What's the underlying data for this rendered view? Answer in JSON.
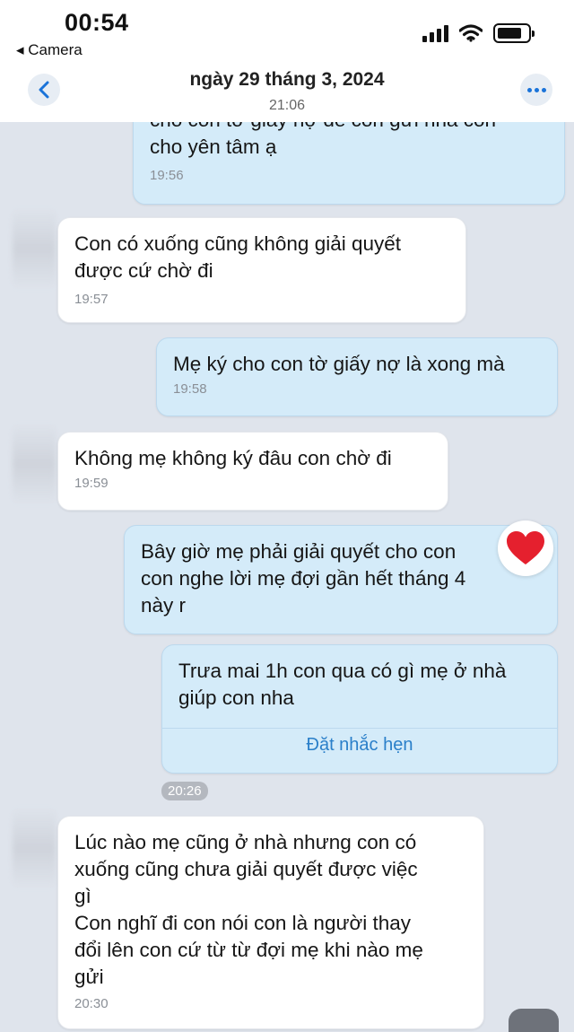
{
  "status_bar": {
    "time": "00:54",
    "back_label": "◂ Camera"
  },
  "header": {
    "title": "ngày 29 tháng 3, 2024",
    "subtitle": "21:06"
  },
  "messages": [
    {
      "direction": "out",
      "text": "cho con tờ giấy nợ để con gửi nha con\ncho yên tâm ạ",
      "time": "19:56"
    },
    {
      "direction": "in",
      "text": "Con có xuống cũng không giải quyết\nđược cứ chờ đi",
      "time": "19:57"
    },
    {
      "direction": "out",
      "text": "Mẹ ký cho con tờ giấy nợ là xong mà",
      "time": "19:58"
    },
    {
      "direction": "in",
      "text": "Không mẹ không ký đâu con chờ đi",
      "time": "19:59"
    },
    {
      "direction": "out",
      "text": "Bây giờ mẹ phải giải quyết cho con\ncon nghe lời mẹ đợi gần hết tháng 4\nnày r",
      "time": "",
      "reaction": "heart"
    },
    {
      "direction": "out",
      "text": "Trưa mai 1h con qua có gì mẹ ở nhà\ngiúp con nha",
      "time": "20:26",
      "action_label": "Đặt nhắc hẹn"
    },
    {
      "direction": "in",
      "text": "Lúc nào mẹ cũng ở nhà nhưng con có\nxuống cũng chưa giải quyết được việc\ngì\nCon nghĩ đi con nói con là người thay\nđổi lên con cứ từ từ đợi mẹ khi nào mẹ\ngửi",
      "time": "20:30"
    }
  ],
  "icons": {
    "back": "chevron-left-icon",
    "more": "more-dots-icon",
    "reaction": "heart-icon"
  },
  "colors": {
    "background": "#dfe4ec",
    "incoming_bubble": "#ffffff",
    "outgoing_bubble": "#d4ebf9",
    "accent": "#1a73d9",
    "heart": "#e5202e"
  }
}
